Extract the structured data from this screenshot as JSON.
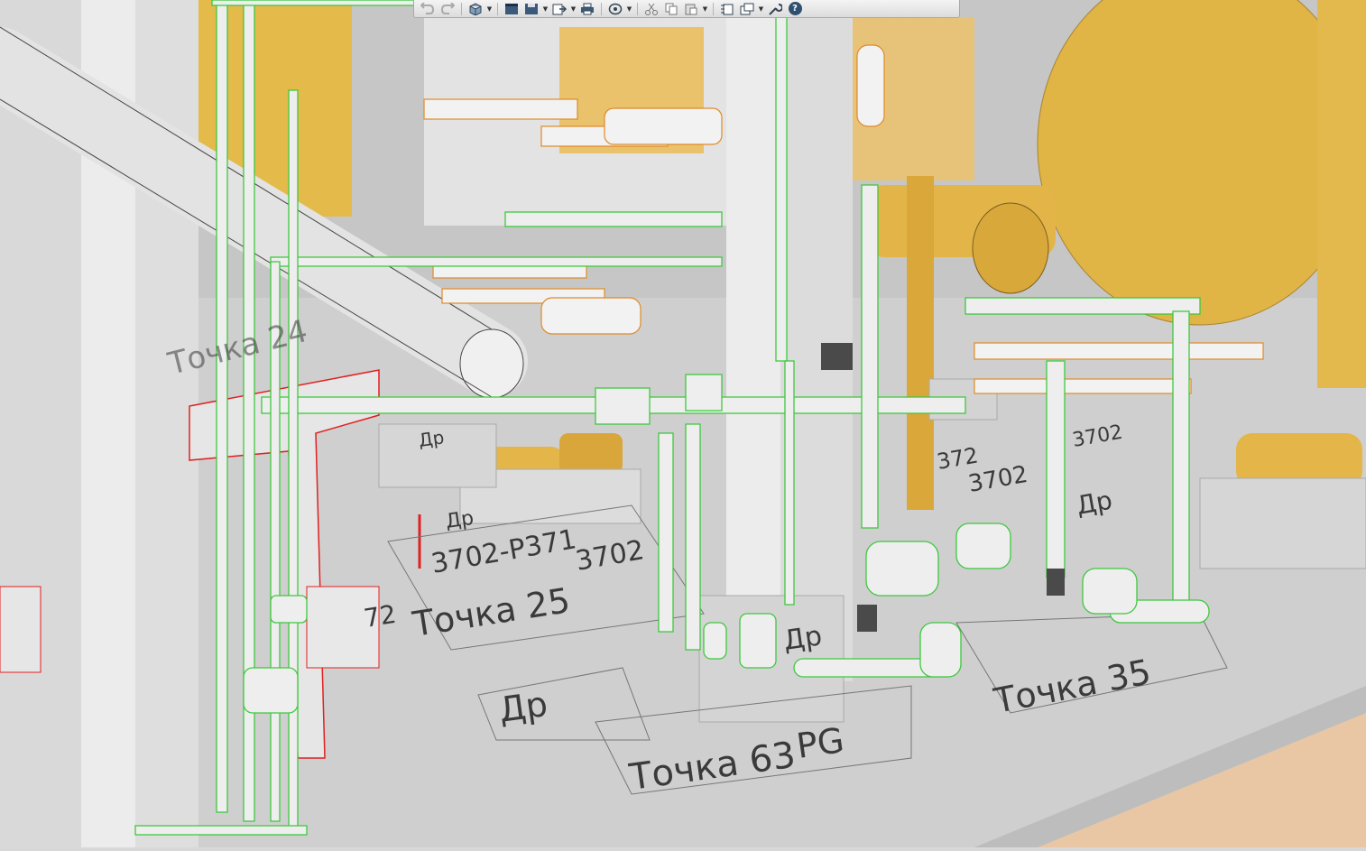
{
  "app": {
    "title": ""
  },
  "toolbar": {
    "buttons": [
      {
        "name": "undo-button",
        "icon": "undo-icon",
        "disabled": true
      },
      {
        "name": "redo-button",
        "icon": "redo-icon",
        "disabled": true
      },
      {
        "name": "view-cube-button",
        "icon": "cube-icon",
        "dropdown": true
      },
      {
        "name": "layout-button",
        "icon": "layout-icon"
      },
      {
        "name": "save-button",
        "icon": "save-icon",
        "dropdown": true
      },
      {
        "name": "export-button",
        "icon": "export-icon",
        "dropdown": true
      },
      {
        "name": "print-button",
        "icon": "printer-icon"
      },
      {
        "name": "orbit-button",
        "icon": "orbit-icon",
        "dropdown": true
      },
      {
        "name": "cut-button",
        "icon": "scissors-icon"
      },
      {
        "name": "copy-button",
        "icon": "copy-icon"
      },
      {
        "name": "paste-button",
        "icon": "paste-icon",
        "dropdown": true
      },
      {
        "name": "properties-button",
        "icon": "properties-icon"
      },
      {
        "name": "window-button",
        "icon": "windows-icon",
        "dropdown": true
      },
      {
        "name": "tools-button",
        "icon": "wrench-icon"
      },
      {
        "name": "help-button",
        "icon": "help-icon",
        "glyph": "?"
      }
    ]
  },
  "scene": {
    "colors": {
      "floor": "#cdcdcd",
      "equipment": "#e2b84b",
      "pipe": "#e4e4e4",
      "selection_green": "#3fc83f",
      "selection_red": "#e02020",
      "orange_outline": "#e08a28",
      "wall": "#bcbcbc",
      "floor_wood": "#e9c7a4"
    },
    "labels": {
      "tochka_24": "Точка 24",
      "tochka_25": "Точка 25",
      "tochka_35": "Точка 35",
      "tochka_63": "Точка 63",
      "dr_1": "Др",
      "dr_2": "Др",
      "dr_3": "Др",
      "dr_4": "Др",
      "dr_5": "Др",
      "pg": "PG",
      "tag_3702": "3702-P371",
      "tag_3702b": "3702",
      "tag_372": "372",
      "tag_3702c": "3702",
      "tag_72": "72",
      "tag_3702d": "3702"
    }
  }
}
